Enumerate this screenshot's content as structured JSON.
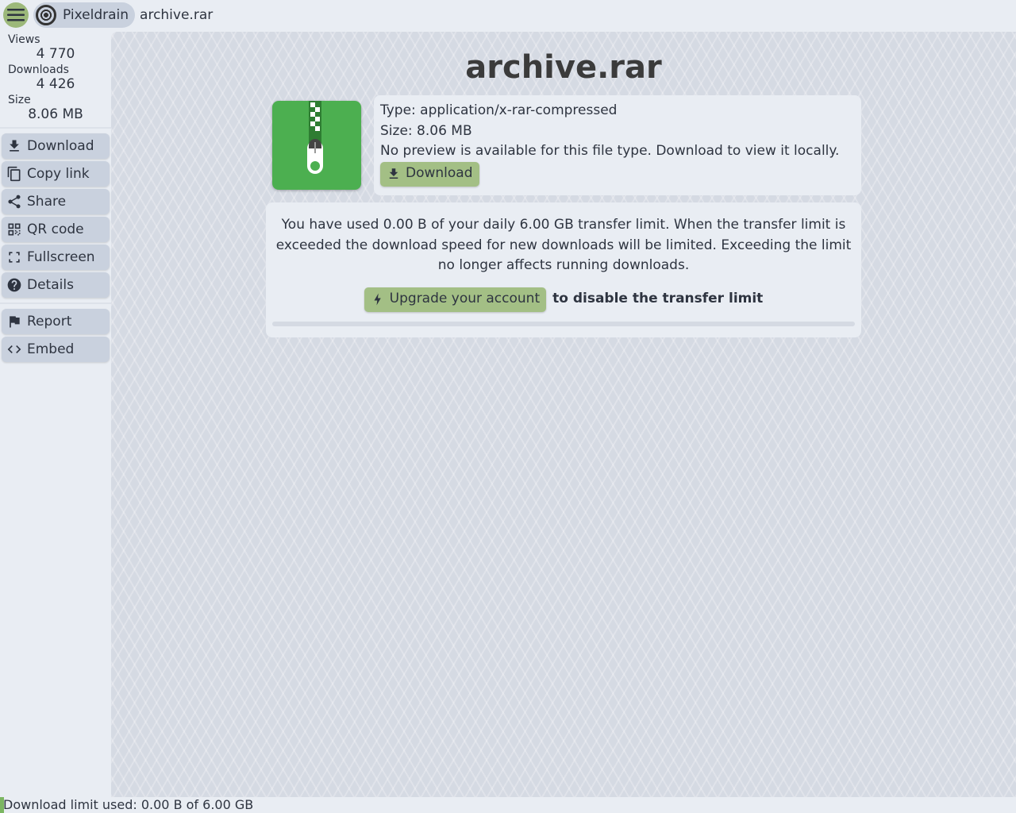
{
  "topbar": {
    "brand": "Pixeldrain",
    "filename": "archive.rar"
  },
  "stats": {
    "views_label": "Views",
    "views": "4 770",
    "downloads_label": "Downloads",
    "downloads": "4 426",
    "size_label": "Size",
    "size": "8.06 MB"
  },
  "sidebar": {
    "download": "Download",
    "copy_link": "Copy link",
    "share": "Share",
    "qr_code": "QR code",
    "fullscreen": "Fullscreen",
    "details": "Details",
    "report": "Report",
    "embed": "Embed"
  },
  "file": {
    "title": "archive.rar",
    "type": "Type: application/x-rar-compressed",
    "size": "Size: 8.06 MB",
    "no_preview": "No preview is available for this file type. Download to view it locally.",
    "download": "Download"
  },
  "limit": {
    "text": "You have used 0.00 B of your daily 6.00 GB transfer limit. When the transfer limit is exceeded the download speed for new downloads will be limited. Exceeding the limit no longer affects running downloads.",
    "upgrade": "Upgrade your account",
    "suffix": "to disable the transfer limit",
    "used_fraction": 0
  },
  "footer": {
    "text": "Download limit used: 0.00 B of 6.00 GB"
  }
}
